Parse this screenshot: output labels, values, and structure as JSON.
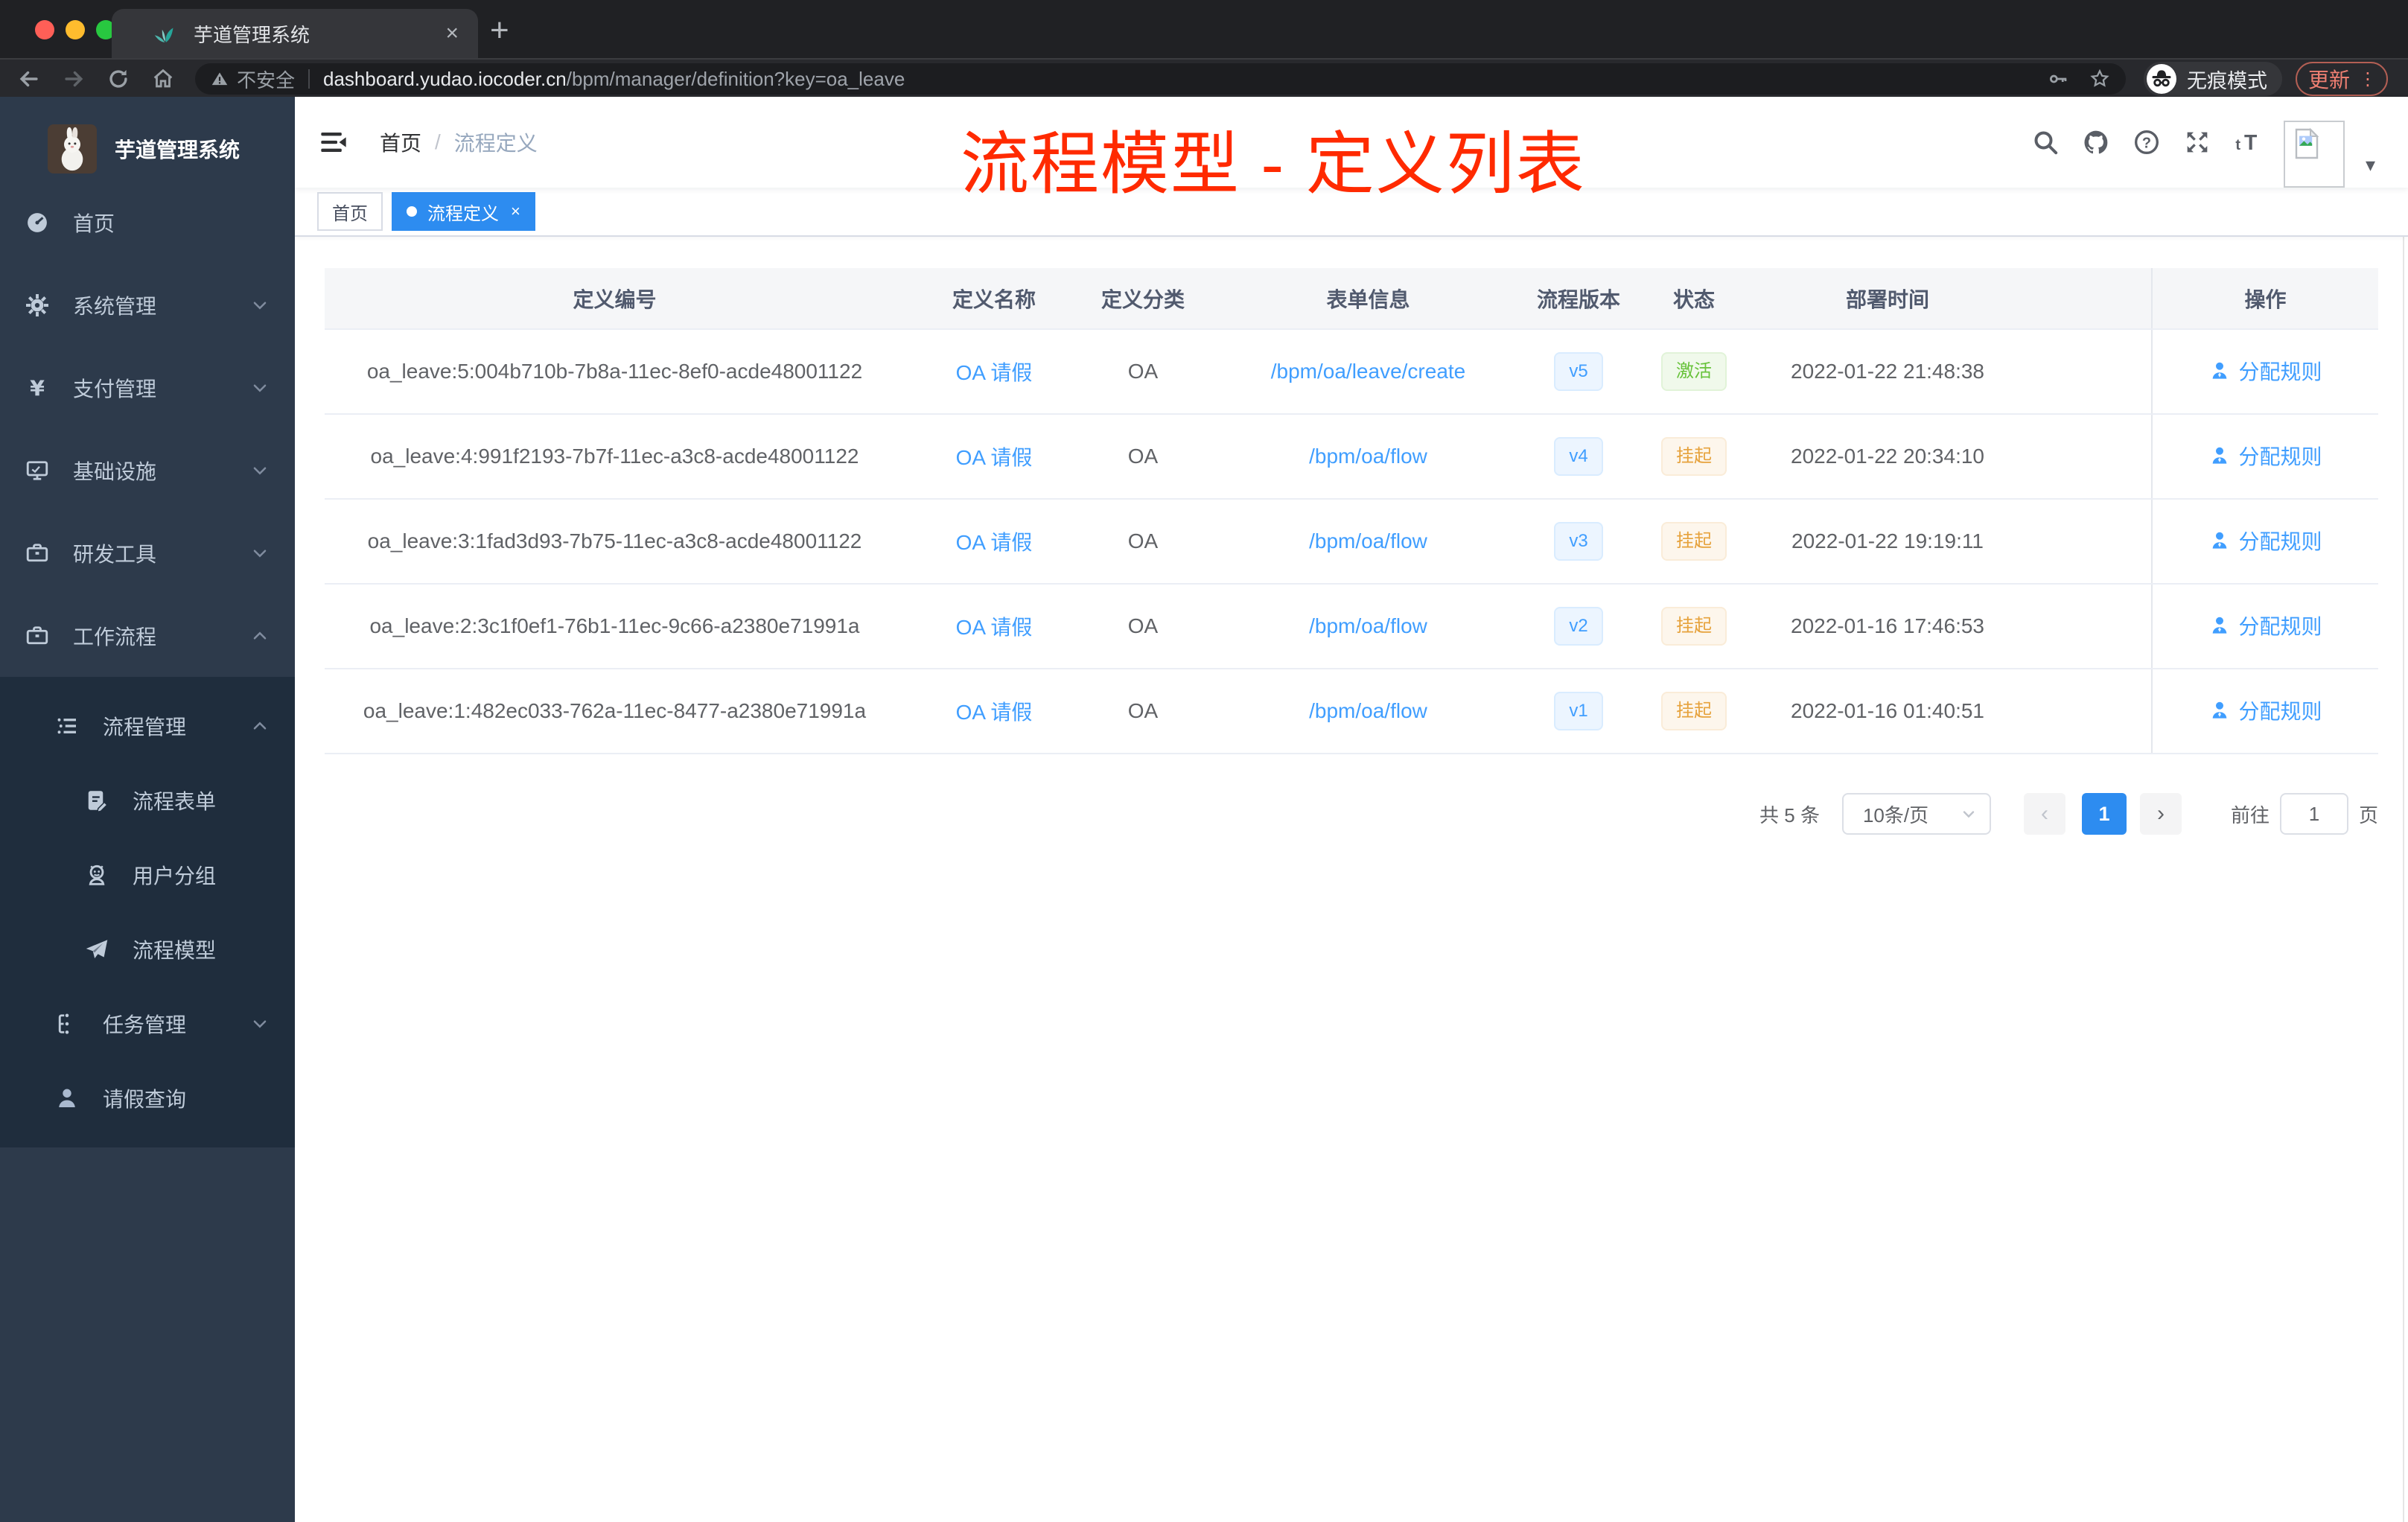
{
  "browser": {
    "tab_title": "芋道管理系统",
    "security_label": "不安全",
    "url_host": "dashboard.yudao.iocoder.cn",
    "url_path": "/bpm/manager/definition?key=oa_leave",
    "incognito_label": "无痕模式",
    "update_label": "更新"
  },
  "sidebar": {
    "logo_title": "芋道管理系统",
    "menu": [
      {
        "label": "首页",
        "icon": "dashboard-icon",
        "level": 1,
        "chevron": "",
        "submenu": false
      },
      {
        "label": "系统管理",
        "icon": "gear-icon",
        "level": 1,
        "chevron": "down",
        "submenu": false
      },
      {
        "label": "支付管理",
        "icon": "yen-icon",
        "level": 1,
        "chevron": "down",
        "submenu": false
      },
      {
        "label": "基础设施",
        "icon": "monitor-icon",
        "level": 1,
        "chevron": "down",
        "submenu": false
      },
      {
        "label": "研发工具",
        "icon": "briefcase-icon",
        "level": 1,
        "chevron": "down",
        "submenu": false
      },
      {
        "label": "工作流程",
        "icon": "briefcase-icon",
        "level": 1,
        "chevron": "up",
        "submenu": false
      },
      {
        "label": "流程管理",
        "icon": "list-icon",
        "level": 2,
        "chevron": "up",
        "submenu": true
      },
      {
        "label": "流程表单",
        "icon": "form-icon",
        "level": 3,
        "chevron": "",
        "submenu": true
      },
      {
        "label": "用户分组",
        "icon": "user-group-icon",
        "level": 3,
        "chevron": "",
        "submenu": true
      },
      {
        "label": "流程模型",
        "icon": "paper-plane-icon",
        "level": 3,
        "chevron": "",
        "submenu": true
      },
      {
        "label": "任务管理",
        "icon": "flow-tree-icon",
        "level": 2,
        "chevron": "down",
        "submenu": true
      },
      {
        "label": "请假查询",
        "icon": "person-icon",
        "level": 2,
        "chevron": "",
        "submenu": true
      }
    ]
  },
  "navbar": {
    "breadcrumb_home": "首页",
    "breadcrumb_separator": "/",
    "breadcrumb_current": "流程定义"
  },
  "annotation": {
    "text": "流程模型 - 定义列表",
    "color": "#FF2A00"
  },
  "tags": {
    "home": "首页",
    "active": "流程定义",
    "close": "×"
  },
  "table": {
    "headers": [
      "定义编号",
      "定义名称",
      "定义分类",
      "表单信息",
      "流程版本",
      "状态",
      "部署时间",
      "操作"
    ],
    "action_label": "分配规则",
    "rows": [
      {
        "id": "oa_leave:5:004b710b-7b8a-11ec-8ef0-acde48001122",
        "name": "OA 请假",
        "category": "OA",
        "form": "/bpm/oa/leave/create",
        "version": "v5",
        "status": "激活",
        "status_type": "active",
        "deployed_at": "2022-01-22 21:48:38"
      },
      {
        "id": "oa_leave:4:991f2193-7b7f-11ec-a3c8-acde48001122",
        "name": "OA 请假",
        "category": "OA",
        "form": "/bpm/oa/flow",
        "version": "v4",
        "status": "挂起",
        "status_type": "suspend",
        "deployed_at": "2022-01-22 20:34:10"
      },
      {
        "id": "oa_leave:3:1fad3d93-7b75-11ec-a3c8-acde48001122",
        "name": "OA 请假",
        "category": "OA",
        "form": "/bpm/oa/flow",
        "version": "v3",
        "status": "挂起",
        "status_type": "suspend",
        "deployed_at": "2022-01-22 19:19:11"
      },
      {
        "id": "oa_leave:2:3c1f0ef1-76b1-11ec-9c66-a2380e71991a",
        "name": "OA 请假",
        "category": "OA",
        "form": "/bpm/oa/flow",
        "version": "v2",
        "status": "挂起",
        "status_type": "suspend",
        "deployed_at": "2022-01-16 17:46:53"
      },
      {
        "id": "oa_leave:1:482ec033-762a-11ec-8477-a2380e71991a",
        "name": "OA 请假",
        "category": "OA",
        "form": "/bpm/oa/flow",
        "version": "v1",
        "status": "挂起",
        "status_type": "suspend",
        "deployed_at": "2022-01-16 01:40:51"
      }
    ]
  },
  "pagination": {
    "total": "共 5 条",
    "page_size": "10条/页",
    "current_page": "1",
    "goto_label": "前往",
    "goto_value": "1",
    "unit_label": "页"
  },
  "colors": {
    "link_blue": "#409EFF",
    "tag_active_blue": "#2D8CF0",
    "status_green": "#67C23A",
    "status_orange": "#E6A23C",
    "annotation_red": "#FF2A00",
    "sidebar_bg": "#2D3A4B",
    "submenu_bg": "#1F2D3D"
  }
}
